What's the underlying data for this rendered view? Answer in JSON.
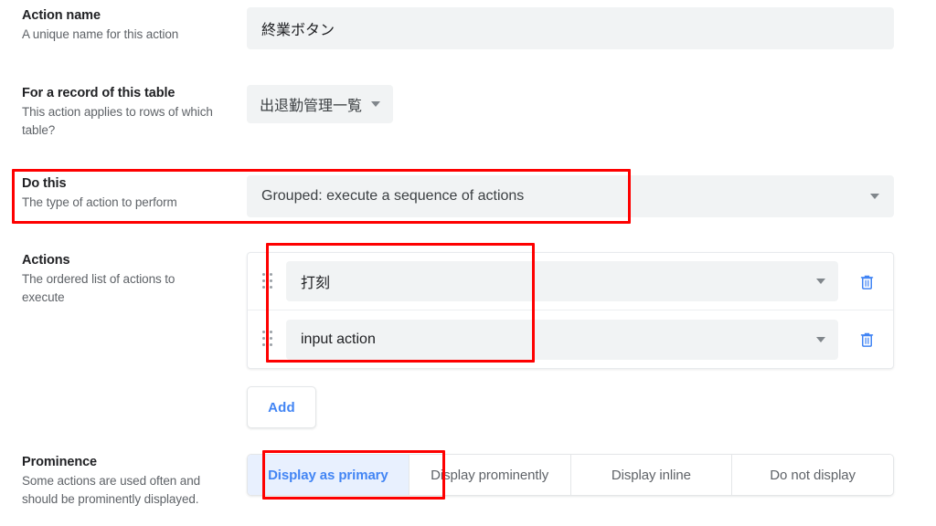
{
  "form": {
    "fields": [
      {
        "title": "Action name",
        "description": "A unique name for this action",
        "value": "終業ボタン"
      },
      {
        "title": "For a record of this table",
        "description": "This action applies to rows of which table?",
        "value": "出退勤管理一覧"
      },
      {
        "title": "Do this",
        "description": "The type of action to perform",
        "value": "Grouped: execute a sequence of actions"
      },
      {
        "title": "Actions",
        "description": "The ordered list of actions to execute"
      },
      {
        "title": "Prominence",
        "description": "Some actions are used often and should be prominently displayed."
      }
    ]
  },
  "actions_list": {
    "rows": [
      {
        "value": "打刻"
      },
      {
        "value": "input action"
      }
    ],
    "add_label": "Add",
    "drag_icon": "drag-handle-icon",
    "delete_icon": "trash-icon",
    "caret_icon": "chevron-down-icon"
  },
  "prominence": {
    "options": [
      {
        "label": "Display as primary",
        "selected": true
      },
      {
        "label": "Display prominently",
        "selected": false
      },
      {
        "label": "Display inline",
        "selected": false
      },
      {
        "label": "Do not display",
        "selected": false
      }
    ]
  },
  "colors": {
    "accent_blue": "#4285f4",
    "selected_bg": "#e8f0fe",
    "field_bg": "#f1f3f4",
    "annotation_red": "#fe0000",
    "label_text": "#202124",
    "desc_text": "#5f6368"
  },
  "annotations": [
    {
      "name": "do-this-highlight"
    },
    {
      "name": "actions-values-highlight"
    },
    {
      "name": "display-as-primary-highlight"
    }
  ]
}
